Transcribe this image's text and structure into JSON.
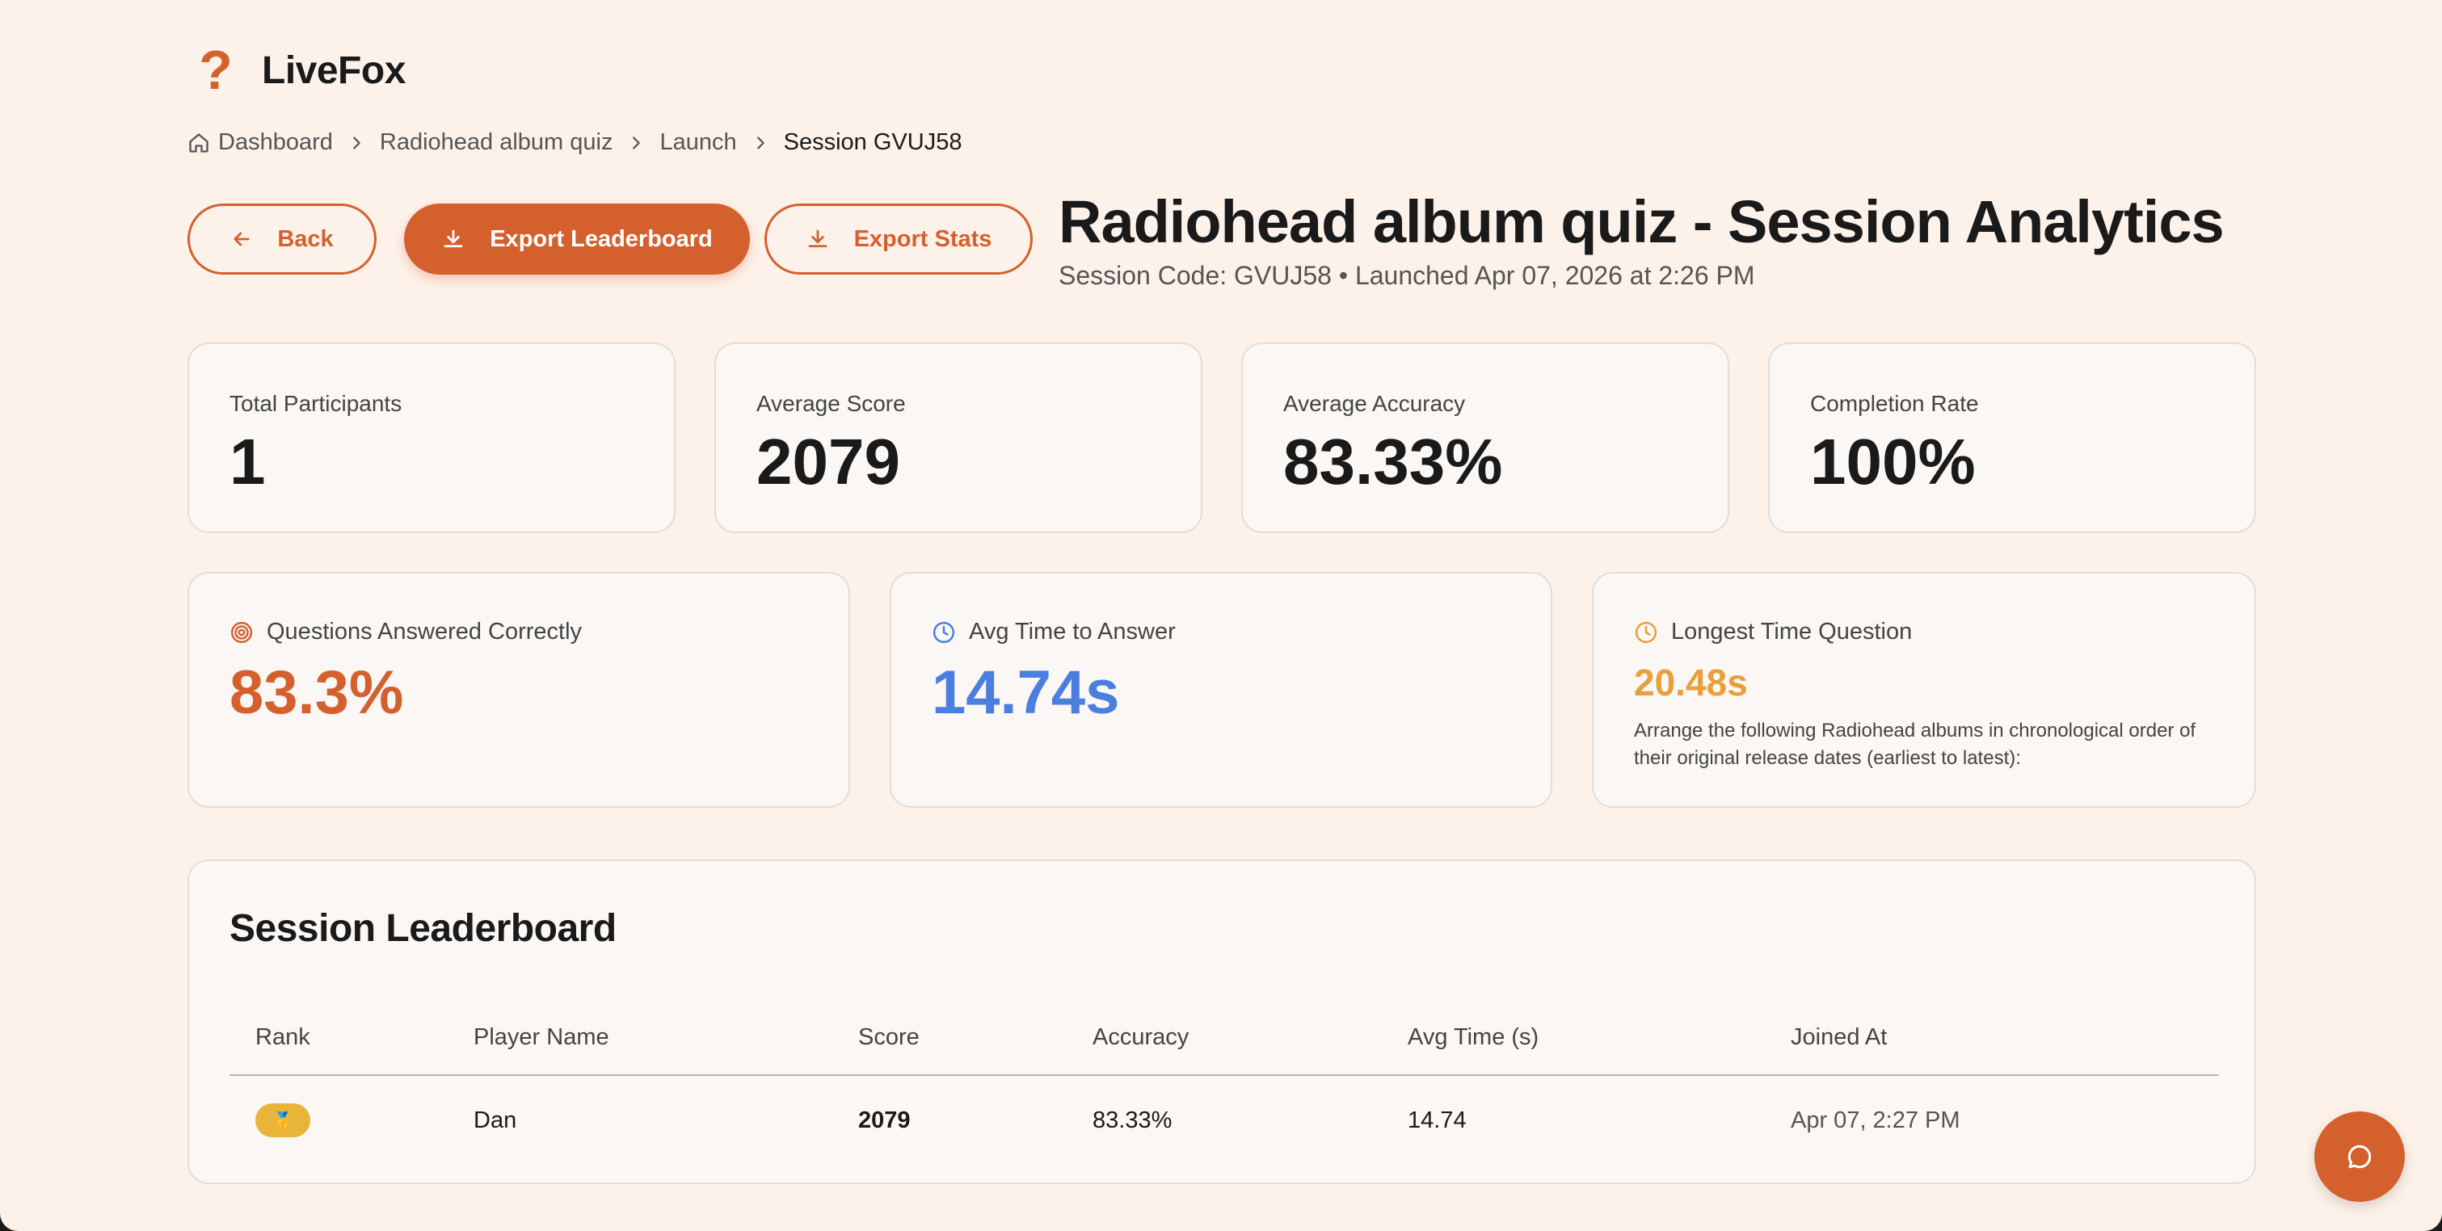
{
  "brand": {
    "name": "LiveFox",
    "logo_glyph": "?"
  },
  "breadcrumb": {
    "items": [
      "Dashboard",
      "Radiohead album quiz",
      "Launch",
      "Session GVUJ58"
    ]
  },
  "toolbar": {
    "back_label": "Back",
    "export_leaderboard_label": "Export Leaderboard",
    "export_stats_label": "Export Stats"
  },
  "header": {
    "title": "Radiohead album quiz - Session Analytics",
    "subtitle": "Session Code: GVUJ58 • Launched Apr 07, 2026 at 2:26 PM"
  },
  "stats": [
    {
      "label": "Total Participants",
      "value": "1"
    },
    {
      "label": "Average Score",
      "value": "2079"
    },
    {
      "label": "Average Accuracy",
      "value": "83.33%"
    },
    {
      "label": "Completion Rate",
      "value": "100%"
    }
  ],
  "metrics": {
    "correct": {
      "label": "Questions Answered Correctly",
      "value": "83.3%",
      "color": "#d4602e",
      "icon": "target-icon"
    },
    "avg_time": {
      "label": "Avg Time to Answer",
      "value": "14.74s",
      "color": "#4a7fe0",
      "icon": "clock-icon"
    },
    "longest": {
      "label": "Longest Time Question",
      "value": "20.48s",
      "color": "#e8a03a",
      "icon": "clock-icon",
      "question": "Arrange the following Radiohead albums in chronological order of their original release dates (earliest to latest):"
    }
  },
  "leaderboard": {
    "title": "Session Leaderboard",
    "columns": [
      "Rank",
      "Player Name",
      "Score",
      "Accuracy",
      "Avg Time (s)",
      "Joined At"
    ],
    "rows": [
      {
        "rank_badge": "🥇",
        "player": "Dan",
        "score": "2079",
        "accuracy": "83.33%",
        "avg_time": "14.74",
        "joined": "Apr 07, 2:27 PM"
      }
    ]
  },
  "colors": {
    "accent": "#d4602e",
    "background": "#fdf2ea",
    "badge_gold": "#e8b43a"
  },
  "chat": {
    "icon": "chat-bubble-icon"
  }
}
